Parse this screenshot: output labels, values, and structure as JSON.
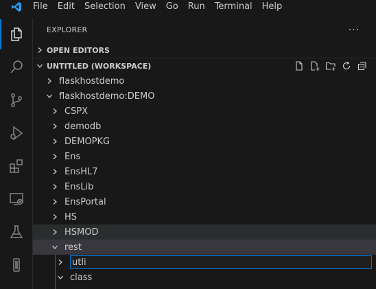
{
  "menu": {
    "logo_icon": "vscode-logo-icon",
    "items": [
      "File",
      "Edit",
      "Selection",
      "View",
      "Go",
      "Run",
      "Terminal",
      "Help"
    ]
  },
  "activity_bar": {
    "icons": [
      "explorer-icon",
      "search-icon",
      "source-control-icon",
      "run-debug-icon",
      "extensions-icon",
      "remote-explorer-icon",
      "testing-icon",
      "docker-icon"
    ],
    "active": "explorer-icon"
  },
  "explorer": {
    "title": "EXPLORER",
    "more_label": "···",
    "open_editors": "OPEN EDITORS",
    "workspace": "UNTITLED (WORKSPACE)",
    "workspace_actions": [
      "new-file-icon",
      "new-folder-icon",
      "refresh-icon",
      "collapse-all-icon"
    ],
    "tree": [
      {
        "label": "flaskhostdemo",
        "expanded": false
      },
      {
        "label": "flaskhostdemo:DEMO",
        "expanded": true
      },
      {
        "label": "CSPX",
        "expanded": false
      },
      {
        "label": "demodb",
        "expanded": false
      },
      {
        "label": "DEMOPKG",
        "expanded": false
      },
      {
        "label": "Ens",
        "expanded": false
      },
      {
        "label": "EnsHL7",
        "expanded": false
      },
      {
        "label": "EnsLib",
        "expanded": false
      },
      {
        "label": "EnsPortal",
        "expanded": false
      },
      {
        "label": "HS",
        "expanded": false
      },
      {
        "label": "HSMOD",
        "expanded": false,
        "state": "hover"
      },
      {
        "label": "rest",
        "expanded": true,
        "state": "selected"
      },
      {
        "label": "utli",
        "expanded": false,
        "editing": true
      },
      {
        "label": "class",
        "expanded": true
      }
    ]
  },
  "colors": {
    "background": "#181818",
    "accent": "#0078d4",
    "text": "#cccccc",
    "hover": "#2a2d2e",
    "selected": "#37373d"
  }
}
